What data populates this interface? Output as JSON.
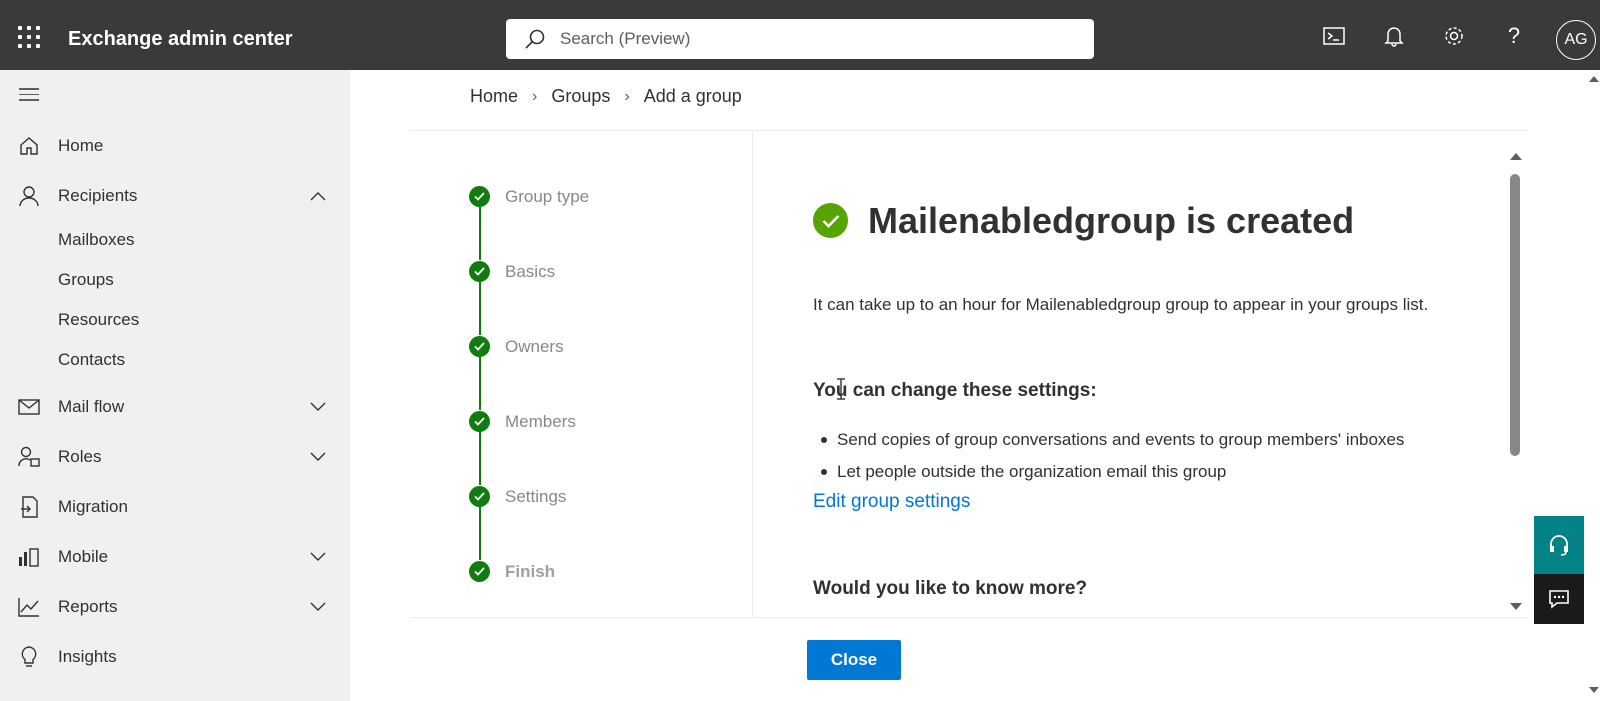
{
  "app": {
    "title": "Exchange admin center"
  },
  "search": {
    "placeholder": "Search (Preview)"
  },
  "topbar_icons": [
    "terminal-icon",
    "bell-icon",
    "gear-icon",
    "help-icon"
  ],
  "user": {
    "initials": "AG"
  },
  "nav": {
    "items": [
      {
        "label": "Home",
        "icon": "home-icon"
      },
      {
        "label": "Recipients",
        "icon": "person-icon",
        "expanded": true,
        "children": [
          "Mailboxes",
          "Groups",
          "Resources",
          "Contacts"
        ]
      },
      {
        "label": "Mail flow",
        "icon": "mail-icon"
      },
      {
        "label": "Roles",
        "icon": "roles-icon"
      },
      {
        "label": "Migration",
        "icon": "migration-icon"
      },
      {
        "label": "Mobile",
        "icon": "mobile-icon"
      },
      {
        "label": "Reports",
        "icon": "reports-icon"
      },
      {
        "label": "Insights",
        "icon": "lightbulb-icon"
      }
    ]
  },
  "breadcrumb": [
    "Home",
    "Groups",
    "Add a group"
  ],
  "wizard": {
    "steps": [
      "Group type",
      "Basics",
      "Owners",
      "Members",
      "Settings",
      "Finish"
    ]
  },
  "result": {
    "title": "Mailenabledgroup is created",
    "info": "It can take up to an hour for Mailenabledgroup group to appear in your groups list.",
    "settings_heading": "You can change these settings:",
    "settings": [
      "Send copies of group conversations and events to group members' inboxes",
      "Let people outside the organization email this group"
    ],
    "edit_link": "Edit group settings",
    "more_heading": "Would you like to know more?"
  },
  "footer": {
    "close_label": "Close"
  },
  "colors": {
    "topbar": "#3b3a39",
    "accent": "#0078d4",
    "success": "#107c10",
    "help": "#038387"
  }
}
